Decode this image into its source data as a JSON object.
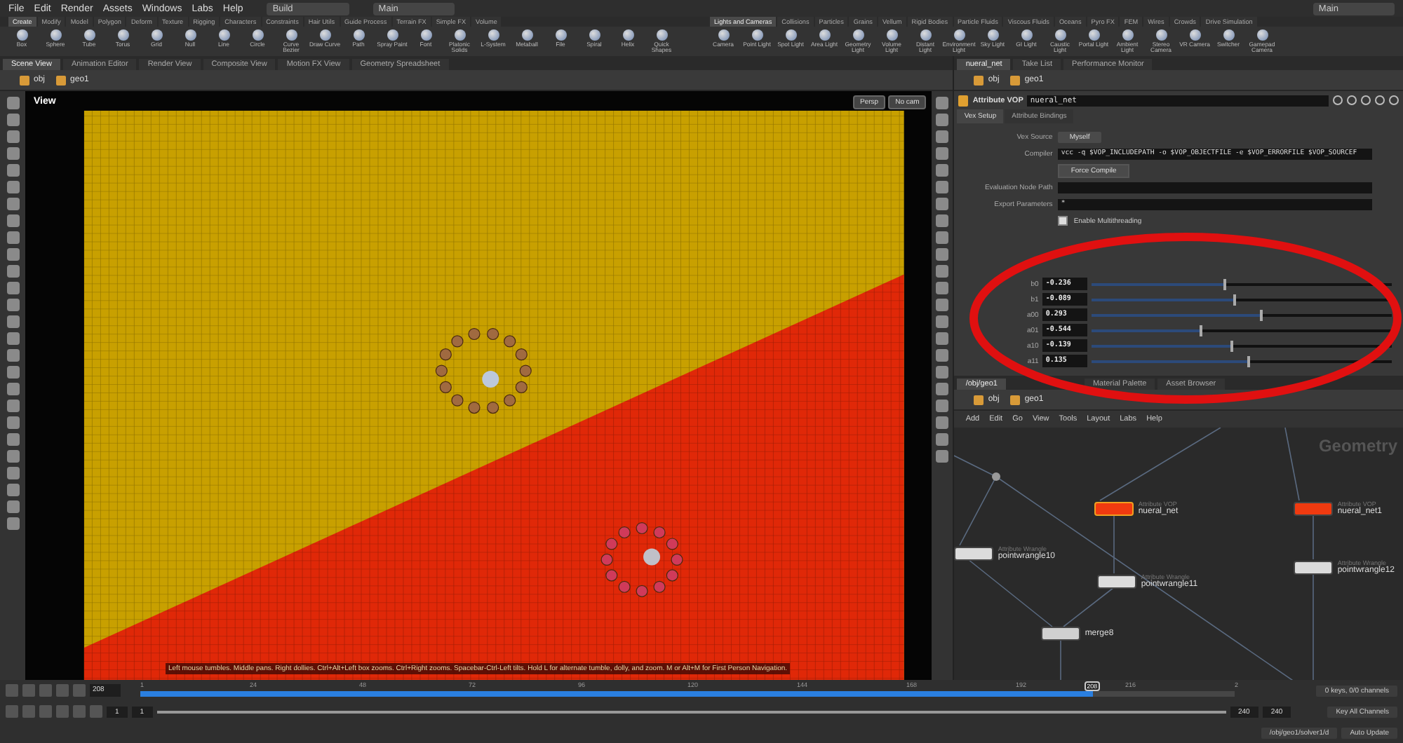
{
  "menu": [
    "File",
    "Edit",
    "Render",
    "Assets",
    "Windows",
    "Labs",
    "Help"
  ],
  "desktop": "Build",
  "context": "Main",
  "context_right": "Main",
  "shelf_left": {
    "tabs": [
      {
        "label": "Create",
        "selected": true
      },
      {
        "label": "Modify",
        "selected": false
      },
      {
        "label": "Model",
        "selected": false
      },
      {
        "label": "Polygon",
        "selected": false
      },
      {
        "label": "Deform",
        "selected": false
      },
      {
        "label": "Texture",
        "selected": false
      },
      {
        "label": "Rigging",
        "selected": false
      },
      {
        "label": "Characters",
        "selected": false
      },
      {
        "label": "Constraints",
        "selected": false
      },
      {
        "label": "Hair Utils",
        "selected": false
      },
      {
        "label": "Guide Process",
        "selected": false
      },
      {
        "label": "Terrain FX",
        "selected": false
      },
      {
        "label": "Simple FX",
        "selected": false
      },
      {
        "label": "Volume",
        "selected": false
      }
    ],
    "tools": [
      "Box",
      "Sphere",
      "Tube",
      "Torus",
      "Grid",
      "Null",
      "Line",
      "Circle",
      "Curve Bezier",
      "Draw Curve",
      "Path",
      "Spray Paint",
      "Font",
      "Platonic Solids",
      "L-System",
      "Metaball",
      "File",
      "Spiral",
      "Helix",
      "Quick Shapes"
    ]
  },
  "shelf_right": {
    "tabs": [
      {
        "label": "Lights and Cameras",
        "selected": true
      },
      {
        "label": "Collisions",
        "selected": false
      },
      {
        "label": "Particles",
        "selected": false
      },
      {
        "label": "Grains",
        "selected": false
      },
      {
        "label": "Vellum",
        "selected": false
      },
      {
        "label": "Rigid Bodies",
        "selected": false
      },
      {
        "label": "Particle Fluids",
        "selected": false
      },
      {
        "label": "Viscous Fluids",
        "selected": false
      },
      {
        "label": "Oceans",
        "selected": false
      },
      {
        "label": "Pyro FX",
        "selected": false
      },
      {
        "label": "FEM",
        "selected": false
      },
      {
        "label": "Wires",
        "selected": false
      },
      {
        "label": "Crowds",
        "selected": false
      },
      {
        "label": "Drive Simulation",
        "selected": false
      }
    ],
    "tools": [
      "Camera",
      "Point Light",
      "Spot Light",
      "Area Light",
      "Geometry Light",
      "Volume Light",
      "Distant Light",
      "Environment Light",
      "Sky Light",
      "GI Light",
      "Caustic Light",
      "Portal Light",
      "Ambient Light",
      "Stereo Camera",
      "VR Camera",
      "Switcher",
      "Gamepad Camera"
    ]
  },
  "viewer_tabs": [
    {
      "label": "Scene View",
      "selected": true
    },
    {
      "label": "Animation Editor",
      "selected": false
    },
    {
      "label": "Render View",
      "selected": false
    },
    {
      "label": "Composite View",
      "selected": false
    },
    {
      "label": "Motion FX View",
      "selected": false
    },
    {
      "label": "Geometry Spreadsheet",
      "selected": false
    }
  ],
  "viewer_path": [
    "obj",
    "geo1"
  ],
  "viewport": {
    "label": "View",
    "camera_buttons": [
      "Persp",
      "No cam"
    ],
    "hint": "Left mouse tumbles. Middle pans. Right dollies. Ctrl+Alt+Left box zooms. Ctrl+Right zooms. Spacebar-Ctrl-Left tilts. Hold L for alternate tumble, dolly, and zoom. M or Alt+M for First Person Navigation."
  },
  "param_tabs": [
    {
      "label": "nueral_net",
      "selected": true
    },
    {
      "label": "Take List",
      "selected": false
    },
    {
      "label": "Performance Monitor",
      "selected": false
    }
  ],
  "param_path": [
    "obj",
    "geo1"
  ],
  "node": {
    "type": "Attribute VOP",
    "name": "nueral_net"
  },
  "param_subtabs": [
    {
      "label": "Vex Setup",
      "selected": true
    },
    {
      "label": "Attribute Bindings",
      "selected": false
    }
  ],
  "params": [
    {
      "kind": "menu",
      "label": "Vex Source",
      "value": "Myself"
    },
    {
      "kind": "text",
      "label": "Compiler",
      "value": "vcc -q $VOP_INCLUDEPATH -o $VOP_OBJECTFILE -e $VOP_ERRORFILE $VOP_SOURCEF"
    },
    {
      "kind": "button",
      "value": "Force Compile"
    },
    {
      "kind": "text",
      "label": "Evaluation Node Path"
    },
    {
      "kind": "text",
      "label": "Export Parameters",
      "value": "*"
    },
    {
      "kind": "toggle",
      "label": "Enable Multithreading",
      "checked": true
    }
  ],
  "sliders": [
    {
      "label": "b0",
      "value": "-0.236",
      "level": 0.44
    },
    {
      "label": "b1",
      "value": "-0.089",
      "level": 0.47
    },
    {
      "label": "a00",
      "value": "0.293",
      "level": 0.56
    },
    {
      "label": "a01",
      "value": "-0.544",
      "level": 0.36
    },
    {
      "label": "a10",
      "value": "-0.139",
      "level": 0.46
    },
    {
      "label": "a11",
      "value": "0.135",
      "level": 0.52
    }
  ],
  "network_tabs": [
    {
      "label": "/obj/geo1",
      "selected": true
    },
    {
      "label": "Material Palette",
      "selected": false
    },
    {
      "label": "Asset Browser",
      "selected": false
    }
  ],
  "network_path": [
    "obj",
    "geo1"
  ],
  "network_menu": [
    "Add",
    "Edit",
    "Go",
    "View",
    "Tools",
    "Layout",
    "Labs",
    "Help"
  ],
  "network_label": "Geometry",
  "nodes": [
    {
      "type": "Attribute VOP",
      "name": "nueral_net",
      "color": "#f03a10",
      "selected": true
    },
    {
      "type": "Attribute VOP",
      "name": "nueral_net1",
      "color": "#f03a10",
      "selected": false
    },
    {
      "type": "Attribute Wrangle",
      "name": "pointwrangle10",
      "color": "#dcdcdc",
      "selected": false
    },
    {
      "type": "Attribute Wrangle",
      "name": "pointwrangle11",
      "color": "#dcdcdc",
      "selected": false
    },
    {
      "type": "Attribute Wrangle",
      "name": "pointwrangle12",
      "color": "#dcdcdc",
      "selected": false
    },
    {
      "name": "merge8",
      "color": "#d0d0d0",
      "selected": false
    }
  ],
  "timeline": {
    "frame": "208",
    "ticks": [
      "1",
      "24",
      "48",
      "72",
      "96",
      "120",
      "144",
      "168",
      "192",
      "216",
      "2"
    ],
    "level": 0.87,
    "marker": "208",
    "start": "1",
    "start_field": "1",
    "end": "240",
    "end_field": "240",
    "keys": "0 keys, 0/0 channels",
    "key_all": "Key All Channels",
    "status_path": "/obj/geo1/solver1/d",
    "update": "Auto Update"
  }
}
